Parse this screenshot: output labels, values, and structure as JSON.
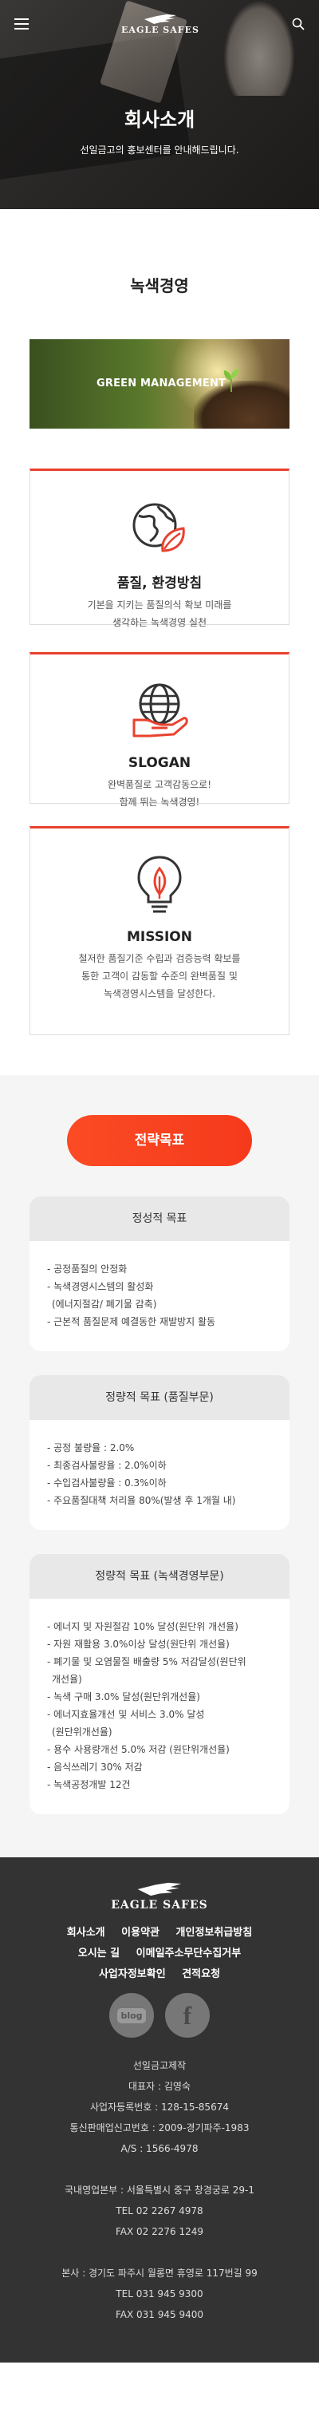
{
  "header": {
    "logo_text": "EAGLE SAFES",
    "menu_icon": "hamburger-menu-icon",
    "search_icon": "search-icon",
    "title": "회사소개",
    "subtitle": "선일금고의 홍보센터를 안내해드립니다."
  },
  "section": {
    "title": "녹색경영",
    "banner_label": "GREEN MANAGEMENT"
  },
  "cards": [
    {
      "icon": "globe-leaf-icon",
      "title": "품질, 환경방침",
      "lines": [
        "기본을 지키는 품질의식 확보 미래를",
        "생각하는 녹색경영 실천"
      ]
    },
    {
      "icon": "globe-hand-icon",
      "title": "SLOGAN",
      "lines": [
        "완벽품질로 고객감동으로!",
        "함께 뛰는 녹색경영!"
      ]
    },
    {
      "icon": "lightbulb-icon",
      "title": "MISSION",
      "lines": [
        "철저한 품질기준 수립과 검증능력 확보를",
        "통한 고객이 감동할 수준의 완벽품질 및",
        "녹색경영시스템을 달성한다."
      ]
    }
  ],
  "strategy": {
    "button_label": "전략목표",
    "goals": [
      {
        "title": "정성적 목표",
        "items": [
          "- 공정품질의 안정화",
          "- 녹색경영시스템의 활성화",
          "  (에너지절감/ 폐기물 감축)",
          "- 근본적 품질문제 예결동한 재발방지 활동"
        ]
      },
      {
        "title": "정량적 목표 (품질부문)",
        "items": [
          "- 공정 불량율 : 2.0%",
          "- 최종검사불량율 : 2.0%이하",
          "- 수입검사불량율 : 0.3%이하",
          "- 주요품질대책 처리율 80%(발생 후 1개월 내)"
        ]
      },
      {
        "title": "정량적 목표 (녹색경영부문)",
        "items": [
          "- 에너지 및 자원절감 10% 달성(원단위 개선율)",
          "- 자원 재활용 3.0%이상 달성(원단위 개선율)",
          "- 폐기물 및 오염물질 배출량 5% 저감달성(원단위",
          "  개선율)",
          "- 녹색 구매 3.0% 달성(원단위개선율)",
          "- 에너지효율개선 및 서비스 3.0% 달성",
          "  (원단위개선율)",
          "- 용수 사용량개선 5.0% 저감 (원단위개선율)",
          "- 음식쓰레기 30% 저감",
          "- 녹색공정개발 12건"
        ]
      }
    ]
  },
  "footer": {
    "logo_text": "EAGLE SAFES",
    "nav": [
      "회사소개",
      "이용약관",
      "개인정보취급방침",
      "오시는 길",
      "이메일주소무단수집거부",
      "사업자정보확인",
      "견적요청"
    ],
    "social": {
      "blog_label": "blog",
      "facebook_label": "f"
    },
    "info_1": [
      "선일금고제작",
      "대표자 : 김영숙",
      "사업자등록번호 : 128-15-85674",
      "통신판매업신고번호 : 2009-경기파주-1983",
      "A/S : 1566-4978"
    ],
    "info_2": [
      "국내영업본부 : 서울특별시 중구 창경궁로 29-1",
      "TEL 02 2267 4978",
      "FAX 02 2276 1249"
    ],
    "info_3": [
      "본사 : 경기도 파주시 월롱면 휴영로 117번길 99",
      "TEL 031 945 9300",
      "FAX 031 945 9400"
    ]
  },
  "colors": {
    "accent": "#f53a1c",
    "footer_bg": "#333333",
    "strategy_bg": "#f5f5f5"
  }
}
